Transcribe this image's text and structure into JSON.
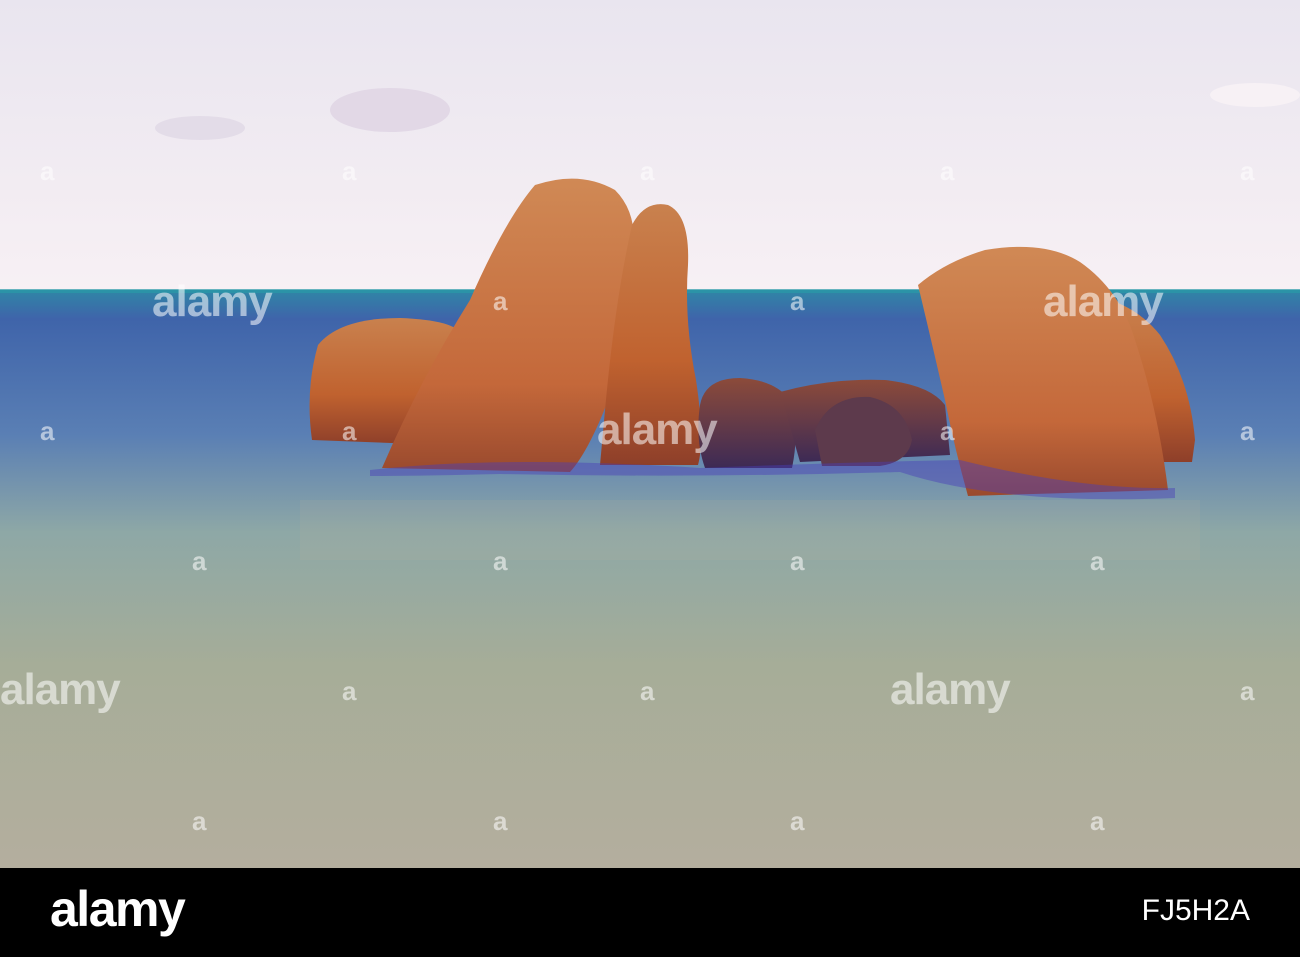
{
  "watermark": {
    "text": "alamy",
    "mark": "a"
  },
  "footer": {
    "logo": "alamy",
    "image_id": "FJ5H2A"
  },
  "colors": {
    "sky_top": "#ece6ee",
    "sky_bottom": "#f6eef3",
    "sea_far": "#3a6fa8",
    "sea_near": "#a9ab97",
    "rock": "#c8673a",
    "footer": "#000000"
  }
}
